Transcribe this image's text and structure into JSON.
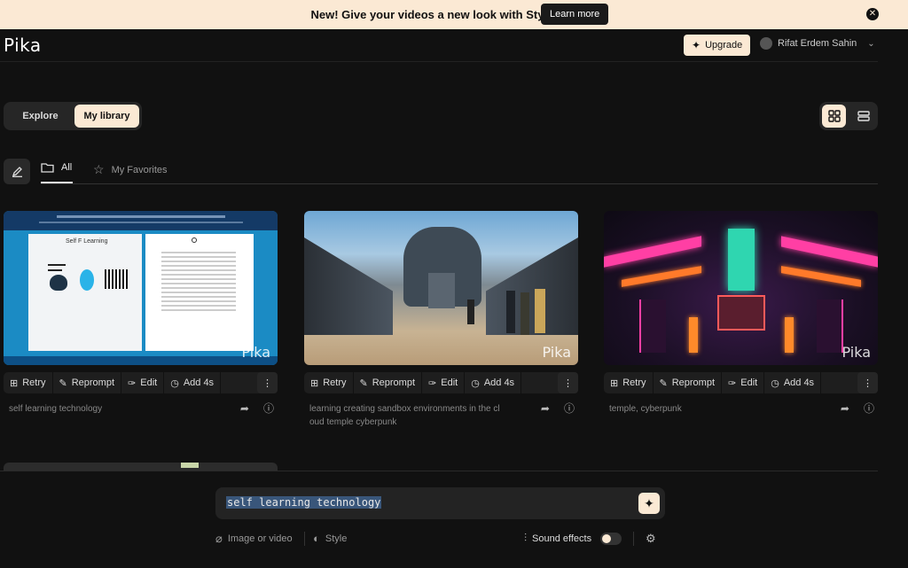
{
  "banner": {
    "text": "New! Give your videos a new look with Styles",
    "cta": "Learn more"
  },
  "header": {
    "logo": "Pika",
    "upgrade_label": "Upgrade",
    "user_name": "Rifat Erdem Sahin"
  },
  "tabs": {
    "explore": "Explore",
    "my_library": "My library",
    "active": "My library"
  },
  "filters": {
    "all": "All",
    "favorites": "My Favorites",
    "active": "All"
  },
  "actions": {
    "retry": "Retry",
    "reprompt": "Reprompt",
    "edit": "Edit",
    "add": "Add 4s"
  },
  "cards": [
    {
      "caption": "self learning technology",
      "watermark": "Pika",
      "thumb_title": "Self F Learning"
    },
    {
      "caption": "learning creating sandbox environments in the cl oud temple cyberpunk",
      "watermark": "Pika"
    },
    {
      "caption": "temple, cyberpunk",
      "watermark": "Pika"
    }
  ],
  "prompt": {
    "value": "self learning technology"
  },
  "options": {
    "image_or_video": "Image or video",
    "style": "Style",
    "sound_effects": "Sound effects",
    "sound_effects_on": false
  },
  "colors": {
    "accent": "#fbe9d4",
    "background": "#111111"
  }
}
